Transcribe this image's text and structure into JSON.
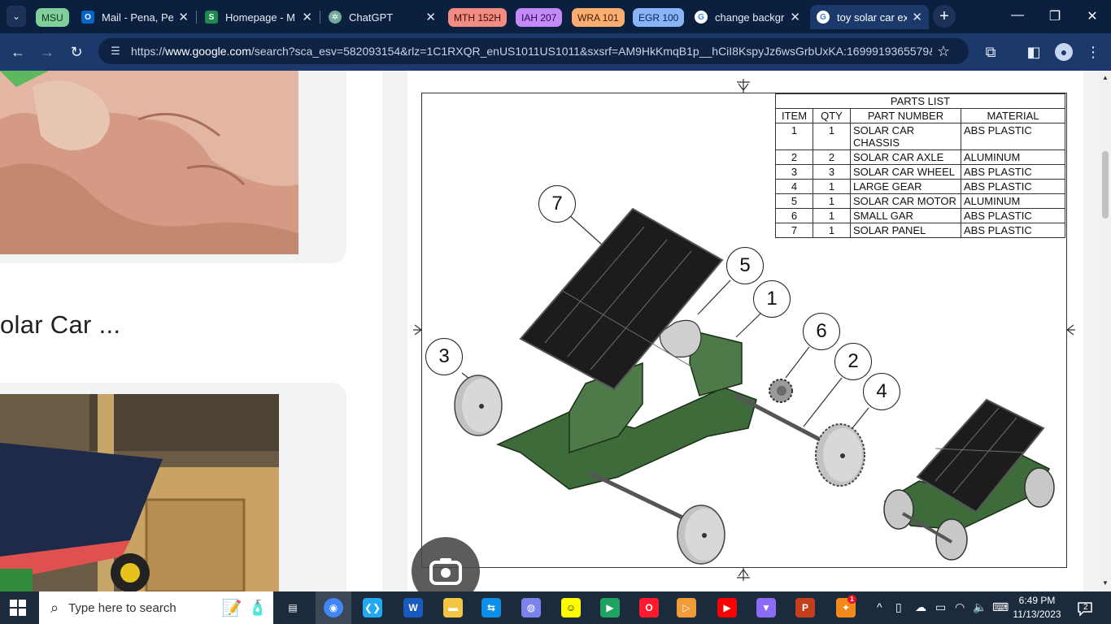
{
  "browser": {
    "tab_groups": [
      {
        "label": "MSU",
        "bg": "#7fd09a",
        "fg": "#10361c"
      },
      {
        "label": "MTH 152H",
        "bg": "#f28b82",
        "fg": "#3b0b07"
      },
      {
        "label": "IAH 207",
        "bg": "#c58af9",
        "fg": "#2a0b48"
      },
      {
        "label": "WRA 101",
        "bg": "#fcad70",
        "fg": "#3f1d02"
      },
      {
        "label": "EGR 100",
        "bg": "#8ab4f8",
        "fg": "#0b2354"
      }
    ],
    "tabs": [
      {
        "title": "Mail - Pena, Pet",
        "icon": "outlook-icon"
      },
      {
        "title": "Homepage - M",
        "icon": "sheets-icon"
      },
      {
        "title": "ChatGPT",
        "icon": "chatgpt-icon"
      },
      {
        "title": "change backgr",
        "icon": "google-icon"
      },
      {
        "title": "toy solar car ex",
        "icon": "google-icon"
      }
    ],
    "url_prefix": "https://",
    "url_domain": "www.google.com",
    "url_path": "/search?sca_esv=582093154&rlz=1C1RXQR_enUS1011US1011&sxsrf=AM9HkKmqB1p__hCiI8KspyJz6wsGrbUxKA:1699919365579&q=t..."
  },
  "results": {
    "title_fragment": "olar Car ..."
  },
  "drawing": {
    "parts_list_title": "PARTS LIST",
    "headers": [
      "ITEM",
      "QTY",
      "PART NUMBER",
      "MATERIAL"
    ],
    "rows": [
      {
        "item": "1",
        "qty": "1",
        "part": "SOLAR CAR CHASSIS",
        "material": "ABS PLASTIC"
      },
      {
        "item": "2",
        "qty": "2",
        "part": "SOLAR CAR AXLE",
        "material": "ALUMINUM"
      },
      {
        "item": "3",
        "qty": "3",
        "part": "SOLAR CAR WHEEL",
        "material": "ABS PLASTIC"
      },
      {
        "item": "4",
        "qty": "1",
        "part": "LARGE GEAR",
        "material": "ABS PLASTIC"
      },
      {
        "item": "5",
        "qty": "1",
        "part": "SOLAR CAR MOTOR",
        "material": "ALUMINUM"
      },
      {
        "item": "6",
        "qty": "1",
        "part": "SMALL GAR",
        "material": "ABS PLASTIC"
      },
      {
        "item": "7",
        "qty": "1",
        "part": "SOLAR PANEL",
        "material": "ABS PLASTIC"
      }
    ],
    "callouts": [
      "7",
      "5",
      "1",
      "6",
      "2",
      "3",
      "4"
    ]
  },
  "taskbar": {
    "search_placeholder": "Type here to search",
    "time": "6:49 PM",
    "date": "11/13/2023",
    "notification_count": "2",
    "badge_count": "1",
    "apps": [
      {
        "name": "task-view-icon",
        "color": "#ffffff"
      },
      {
        "name": "chrome-icon",
        "color": "#4285f4"
      },
      {
        "name": "vscode-icon",
        "color": "#23a9f2"
      },
      {
        "name": "word-icon",
        "color": "#185abd"
      },
      {
        "name": "file-explorer-icon",
        "color": "#f4c542"
      },
      {
        "name": "teamviewer-icon",
        "color": "#0e8ee9"
      },
      {
        "name": "chat-icon",
        "color": "#7b83eb"
      },
      {
        "name": "snapchat-icon",
        "color": "#fffc00"
      },
      {
        "name": "google-meet-icon",
        "color": "#1ea362"
      },
      {
        "name": "opera-icon",
        "color": "#ff1b2d"
      },
      {
        "name": "media-player-icon",
        "color": "#f29c38"
      },
      {
        "name": "youtube-music-icon",
        "color": "#ff0000"
      },
      {
        "name": "vpn-icon",
        "color": "#8b6cf6"
      },
      {
        "name": "powerpoint-icon",
        "color": "#c43e1c"
      },
      {
        "name": "game-icon",
        "color": "#f28a1a"
      }
    ]
  }
}
